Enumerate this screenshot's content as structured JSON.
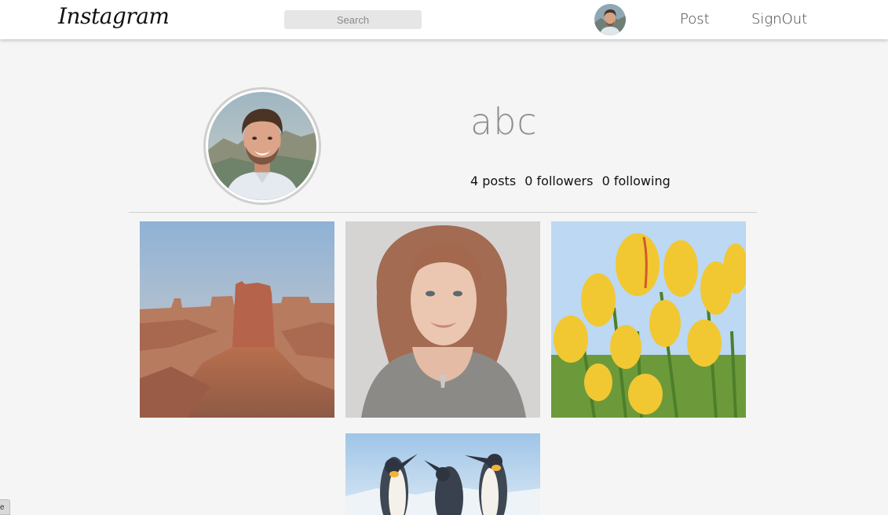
{
  "header": {
    "logo_text": "Instagram",
    "search_placeholder": "Search",
    "search_value": "",
    "nav": {
      "post_label": "Post",
      "signout_label": "SignOut"
    }
  },
  "profile": {
    "username": "abc",
    "stats": {
      "posts": "4 posts",
      "followers": "0 followers",
      "following": "0 following"
    }
  },
  "posts": [
    {
      "subject": "desert-butte-photo"
    },
    {
      "subject": "woman-portrait-photo"
    },
    {
      "subject": "yellow-tulips-photo"
    },
    {
      "subject": "penguins-photo"
    }
  ],
  "colors": {
    "header_bg": "#ffffff",
    "page_bg": "#f5f5f5",
    "username": "#8f8f8f",
    "search_bg": "#e6e6e6"
  },
  "misc": {
    "corner_tab_text": "e"
  }
}
